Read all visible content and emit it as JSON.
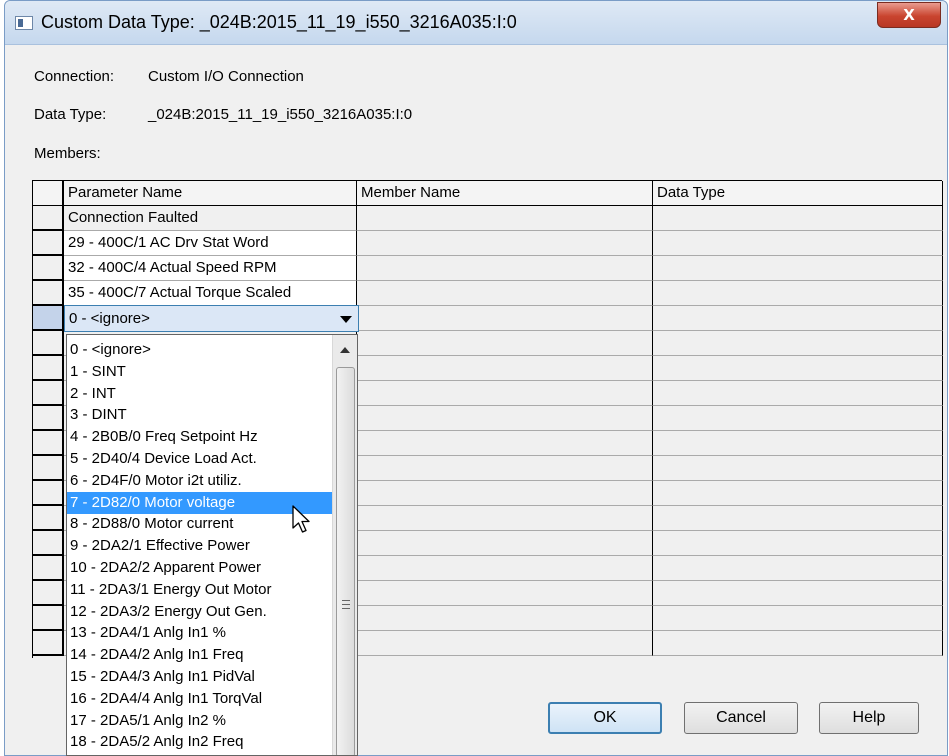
{
  "window": {
    "title": "Custom Data Type:  _024B:2015_11_19_i550_3216A035:I:0",
    "close_label": "X"
  },
  "fields": {
    "connection_label": "Connection:",
    "connection_value": "Custom I/O Connection",
    "datatype_label": "Data Type:",
    "datatype_value": "_024B:2015_11_19_i550_3216A035:I:0",
    "members_label": "Members:"
  },
  "grid": {
    "columns": [
      "Parameter Name",
      "Member Name",
      "Data Type"
    ],
    "rows": [
      {
        "param": "Connection Faulted",
        "member": "",
        "type": ""
      },
      {
        "param": "29 - 400C/1 AC Drv Stat Word",
        "member": "",
        "type": ""
      },
      {
        "param": "32 - 400C/4 Actual Speed RPM",
        "member": "",
        "type": ""
      },
      {
        "param": "35 - 400C/7 Actual Torque Scaled",
        "member": "",
        "type": ""
      }
    ]
  },
  "combo": {
    "value": "0 - <ignore>"
  },
  "dropdown": {
    "selected_index": 7,
    "options": [
      "0 - <ignore>",
      "1 - SINT",
      "2 - INT",
      "3 - DINT",
      "4 - 2B0B/0 Freq Setpoint Hz",
      "5 - 2D40/4 Device Load Act.",
      "6 - 2D4F/0 Motor i2t utiliz.",
      "7 - 2D82/0 Motor voltage",
      "8 - 2D88/0 Motor current",
      "9 - 2DA2/1 Effective Power",
      "10 - 2DA2/2 Apparent Power",
      "11 - 2DA3/1 Energy Out Motor",
      "12 - 2DA3/2 Energy Out Gen.",
      "13 - 2DA4/1 Anlg In1 %",
      "14 - 2DA4/2 Anlg In1 Freq",
      "15 - 2DA4/3 Anlg In1 PidVal",
      "16 - 2DA4/4 Anlg In1 TorqVal",
      "17 - 2DA5/1 Anlg In2 %",
      "18 - 2DA5/2 Anlg In2 Freq"
    ]
  },
  "buttons": {
    "ok": "OK",
    "cancel": "Cancel",
    "help": "Help"
  },
  "colors": {
    "selection": "#3399ff",
    "close": "#c9442f",
    "titlebar": "#c5d8ee"
  }
}
